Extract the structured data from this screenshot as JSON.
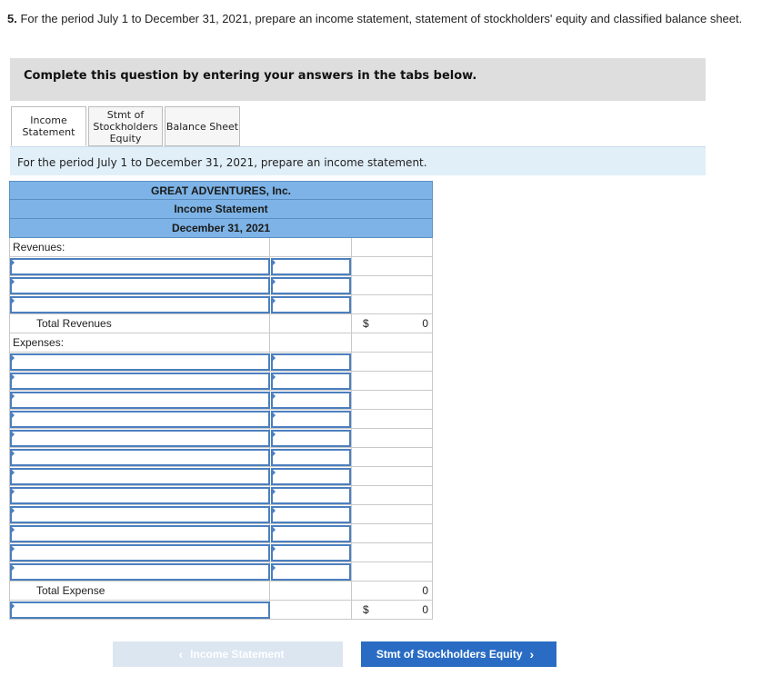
{
  "question": {
    "number": "5.",
    "text": "For the period July 1 to December 31, 2021, prepare an income statement, statement of stockholders' equity and classified balance sheet."
  },
  "instruction": "Complete this question by entering your answers in the tabs below.",
  "tabs": [
    {
      "label_lines": [
        "Income",
        "Statement"
      ],
      "active": true
    },
    {
      "label_lines": [
        "Stmt of",
        "Stockholders",
        "Equity"
      ],
      "active": false
    },
    {
      "label_lines": [
        "Balance Sheet"
      ],
      "active": false
    }
  ],
  "prompt": "For the period July 1 to December 31, 2021, prepare an income statement.",
  "statement": {
    "company": "GREAT ADVENTURES, Inc.",
    "title": "Income Statement",
    "date": "December 31, 2021",
    "revenues_label": "Revenues:",
    "total_revenues_label": "Total Revenues",
    "total_revenues_currency": "$",
    "total_revenues_value": "0",
    "expenses_label": "Expenses:",
    "total_expense_label": "Total Expense",
    "total_expense_value": "0",
    "net_currency": "$",
    "net_value": "0"
  },
  "nav": {
    "prev_label": "Income Statement",
    "next_label": "Stmt of Stockholders Equity",
    "prev_icon": "chevron-left-icon",
    "next_icon": "chevron-right-icon"
  },
  "colors": {
    "header_blue": "#7db3e6",
    "input_border": "#4b7fbf",
    "next_button": "#2a6cc4",
    "prompt_bar": "#e1eff9"
  }
}
